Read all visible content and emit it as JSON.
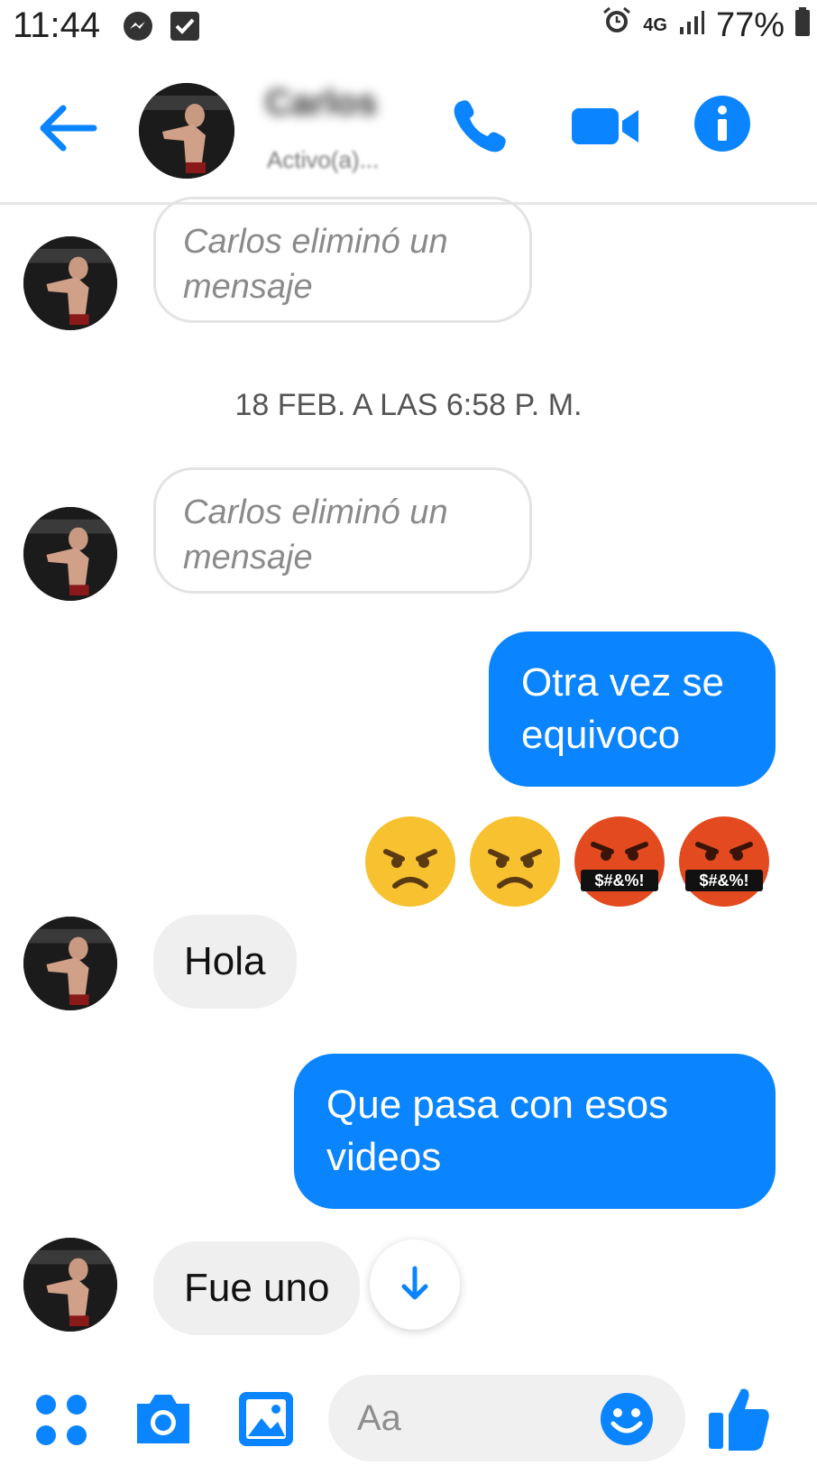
{
  "status_bar": {
    "time": "11:44",
    "network": "4G",
    "battery": "77%"
  },
  "header": {
    "contact_name": "Carlos",
    "contact_status": "Activo(a)..."
  },
  "messages": {
    "deleted_1": "Carlos eliminó un mensaje",
    "timestamp": "18 FEB. A LAS 6:58 P. M.",
    "deleted_2": "Carlos eliminó un mensaje",
    "out_1": "Otra vez se equivoco",
    "emoji_badge": "$#&%!",
    "in_1": "Hola",
    "out_2": "Que pasa con esos videos",
    "in_2": "Fue uno"
  },
  "composer": {
    "placeholder": "Aa"
  },
  "colors": {
    "accent": "#0a84ff",
    "incoming_bubble": "#efefef",
    "emoji_yellow": "#f7c12f",
    "emoji_red": "#e34a1f"
  }
}
